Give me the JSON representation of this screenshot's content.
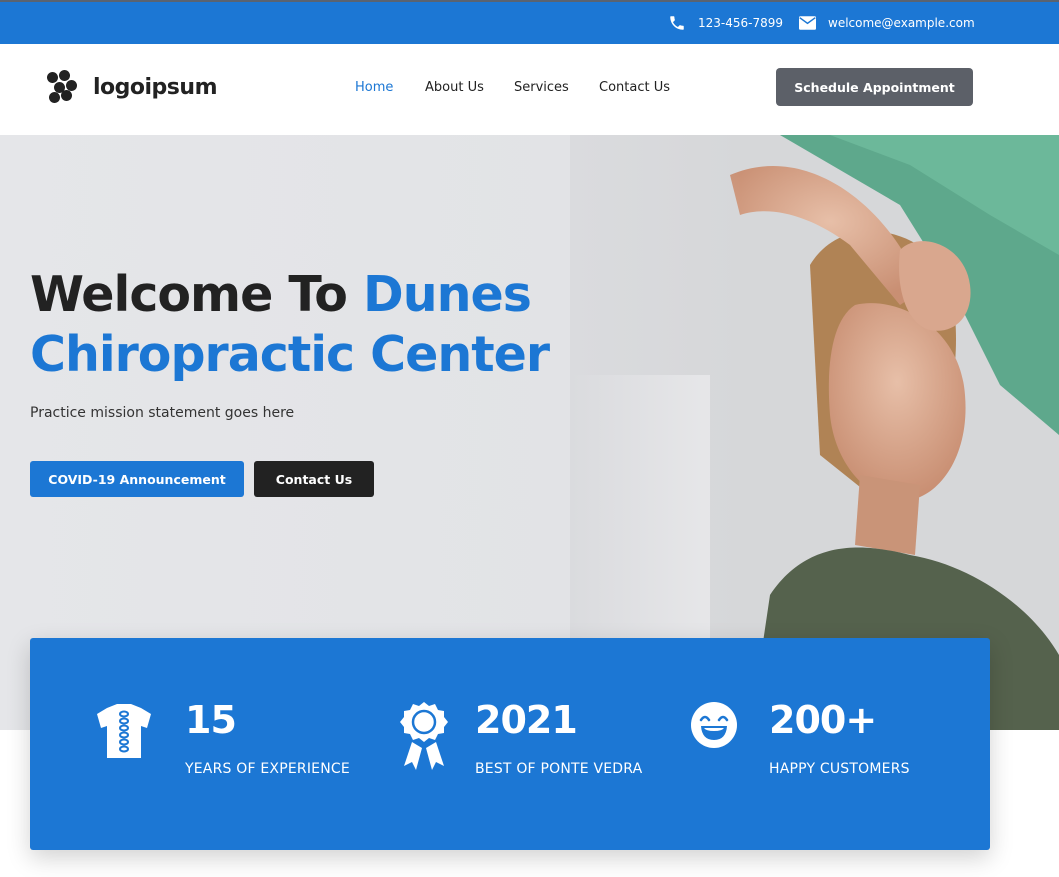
{
  "topbar": {
    "phone": "123-456-7899",
    "email": "welcome@example.com",
    "phone_icon": "phone-icon",
    "email_icon": "envelope-icon"
  },
  "header": {
    "logo_text": "logoipsum",
    "nav": [
      {
        "label": "Home",
        "active": true
      },
      {
        "label": "About Us",
        "active": false
      },
      {
        "label": "Services",
        "active": false
      },
      {
        "label": "Contact Us",
        "active": false
      }
    ],
    "cta": "Schedule Appointment"
  },
  "hero": {
    "title_part1": "Welcome To ",
    "title_part2": "Dunes",
    "title_line2": "Chiropractic Center",
    "mission": "Practice mission statement goes here",
    "btn_primary": "COVID-19 Announcement",
    "btn_secondary": "Contact Us"
  },
  "stats": [
    {
      "icon": "spine-icon",
      "value": "15",
      "label": "YEARS OF EXPERIENCE"
    },
    {
      "icon": "award-ribbon-icon",
      "value": "2021",
      "label": "BEST OF PONTE VEDRA"
    },
    {
      "icon": "smiley-face-icon",
      "value": "200+",
      "label": "HAPPY CUSTOMERS"
    }
  ],
  "colors": {
    "brand_blue": "#1c77d4",
    "dark_button": "#222222",
    "schedule_button": "#5c6068"
  }
}
